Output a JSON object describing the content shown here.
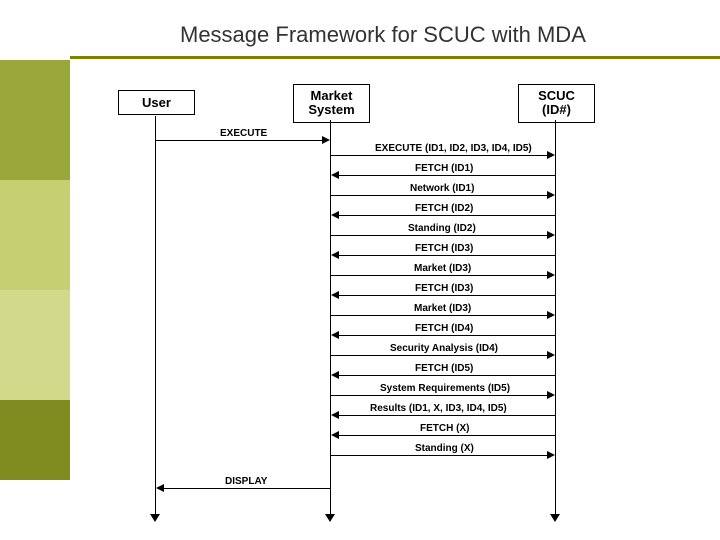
{
  "title": "Message Framework for SCUC with MDA",
  "side_colors": [
    "#9aa73a",
    "#c6cf71",
    "#d2d98a",
    "#7f8a1f"
  ],
  "actors": {
    "user": "User",
    "market": "Market\nSystem",
    "scuc": "SCUC\n(ID#)"
  },
  "msgs": {
    "m1": "EXECUTE",
    "m2": "EXECUTE (ID1, ID2, ID3, ID4, ID5)",
    "m3": "FETCH (ID1)",
    "m4": "Network (ID1)",
    "m5": "FETCH (ID2)",
    "m6": "Standing (ID2)",
    "m7": "FETCH (ID3)",
    "m8": "Market (ID3)",
    "m9": "FETCH (ID3)",
    "m10": "Market (ID3)",
    "m11": "FETCH (ID4)",
    "m12": "Security Analysis (ID4)",
    "m13": "FETCH (ID5)",
    "m14": "System Requirements (ID5)",
    "m15": "Results (ID1, X, ID3, ID4, ID5)",
    "m16": "FETCH (X)",
    "m17": "Standing (X)",
    "m18": "DISPLAY"
  }
}
